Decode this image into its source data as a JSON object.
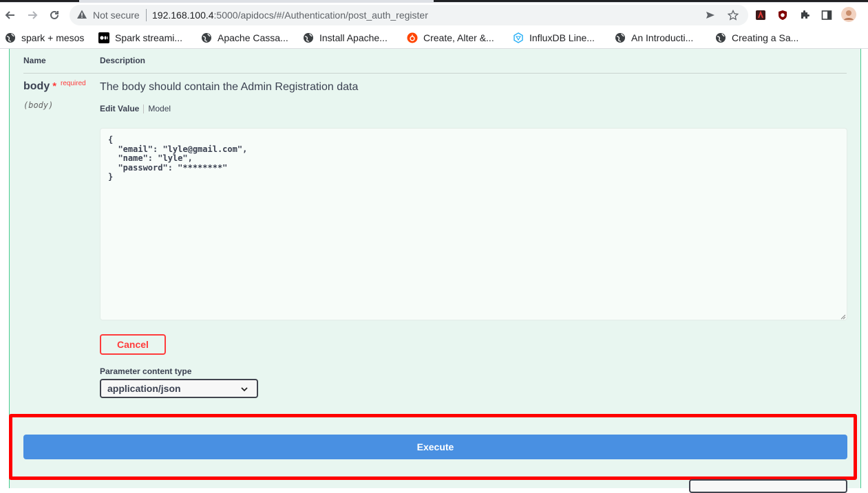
{
  "browser": {
    "security_label": "Not secure",
    "url_host": "192.168.100.4",
    "url_rest": ":5000/apidocs/#/Authentication/post_auth_register",
    "bookmarks": [
      {
        "label": "spark + mesos",
        "icon": "globe-icon"
      },
      {
        "label": "Spark streami...",
        "icon": "medium-icon"
      },
      {
        "label": "Apache Cassa...",
        "icon": "globe-icon"
      },
      {
        "label": "Install Apache...",
        "icon": "globe-icon"
      },
      {
        "label": "Create, Alter &...",
        "icon": "site-icon"
      },
      {
        "label": "InfluxDB Line...",
        "icon": "influx-icon"
      },
      {
        "label": "An Introducti...",
        "icon": "globe-icon"
      },
      {
        "label": "Creating a Sa...",
        "icon": "globe-icon"
      }
    ]
  },
  "params": {
    "header_name": "Name",
    "header_description": "Description",
    "param_name": "body",
    "required_star": "*",
    "required_label": "required",
    "param_in": "(body)",
    "description": "The body should contain the Admin Registration data",
    "tab_edit": "Edit Value",
    "tab_model": "Model",
    "body_value": "{\n  \"email\": \"lyle@gmail.com\",\n  \"name\": \"lyle\",\n  \"password\": \"********\"\n}",
    "cancel_label": "Cancel",
    "content_type_label": "Parameter content type",
    "content_type_value": "application/json",
    "execute_label": "Execute"
  },
  "colors": {
    "panel_bg": "#e8f6f0",
    "panel_border": "#49cc90",
    "execute_bg": "#4990e2",
    "cancel": "#ff3b3b",
    "highlight": "#ff0000"
  }
}
